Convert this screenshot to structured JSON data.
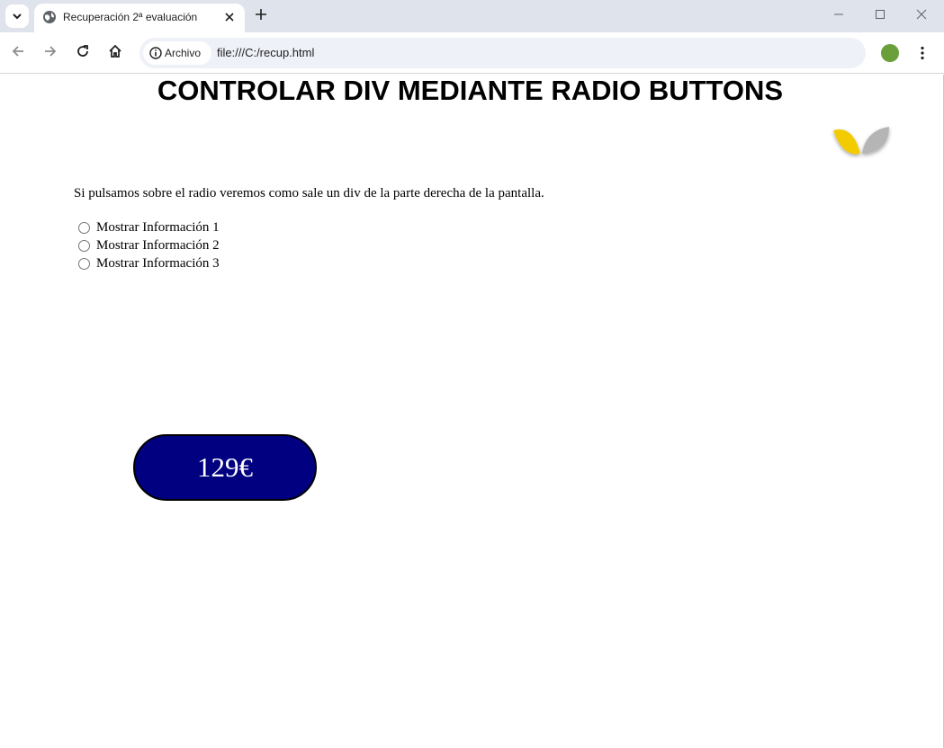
{
  "browser": {
    "tab_title": "Recuperación 2ª evaluación",
    "site_chip_label": "Archivo",
    "url": "file:///C:/recup.html",
    "profile_color": "#6a9f3b"
  },
  "page": {
    "title": "CONTROLAR DIV MEDIANTE RADIO BUTTONS",
    "intro": "Si pulsamos sobre el radio veremos como sale un div de la parte derecha de la pantalla.",
    "radios": [
      {
        "label": "Mostrar Información 1",
        "checked": false
      },
      {
        "label": "Mostrar Información 2",
        "checked": false
      },
      {
        "label": "Mostrar Información 3",
        "checked": false
      }
    ],
    "price": "129€",
    "price_bg": "#000080",
    "logo_colors": {
      "left_leaf": "#f2cc00",
      "right_leaf": "#b5b5b5"
    }
  }
}
